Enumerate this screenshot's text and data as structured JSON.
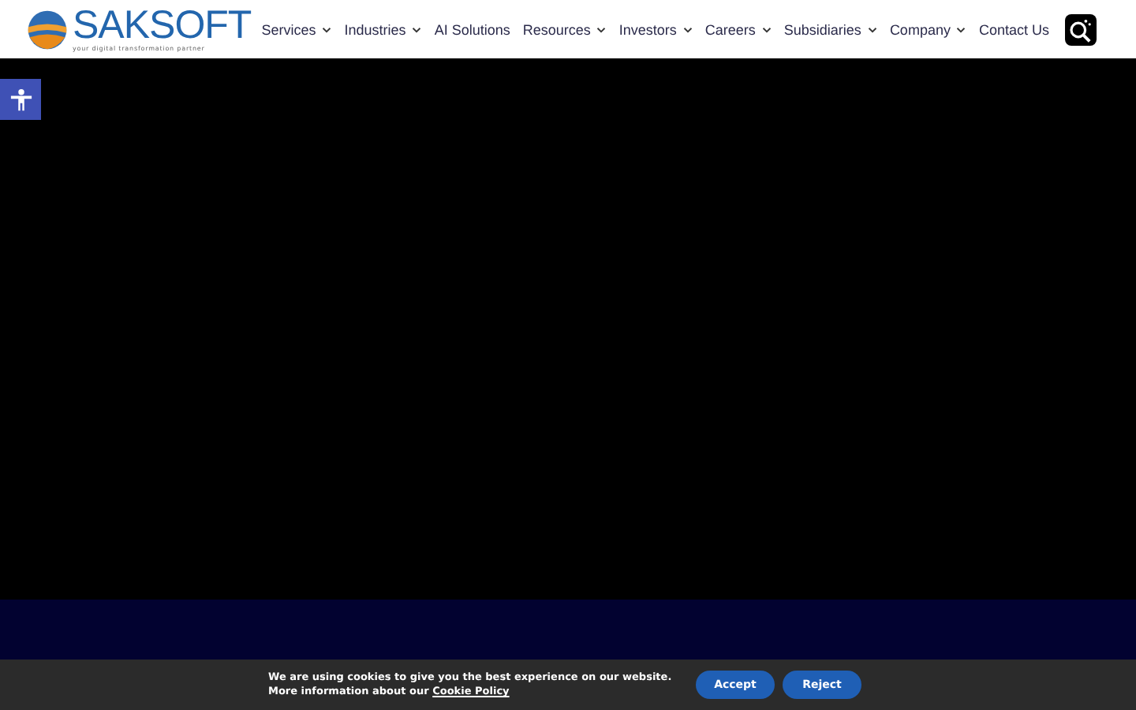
{
  "logo": {
    "name": "SAKSOFT",
    "tagline": "your digital transformation partner"
  },
  "nav": [
    {
      "label": "Services",
      "dropdown": true
    },
    {
      "label": "Industries",
      "dropdown": true
    },
    {
      "label": "AI Solutions",
      "dropdown": false
    },
    {
      "label": "Resources",
      "dropdown": true
    },
    {
      "label": "Investors",
      "dropdown": true
    },
    {
      "label": "Careers",
      "dropdown": true
    },
    {
      "label": "Subsidiaries",
      "dropdown": true
    },
    {
      "label": "Company",
      "dropdown": true
    },
    {
      "label": "Contact Us",
      "dropdown": false
    }
  ],
  "cookie_bar": {
    "text": "We are using cookies to give you the best experience on our website.",
    "more": "More information about our",
    "link": "Cookie Policy",
    "buttons": [
      "Accept",
      "Reject"
    ]
  }
}
